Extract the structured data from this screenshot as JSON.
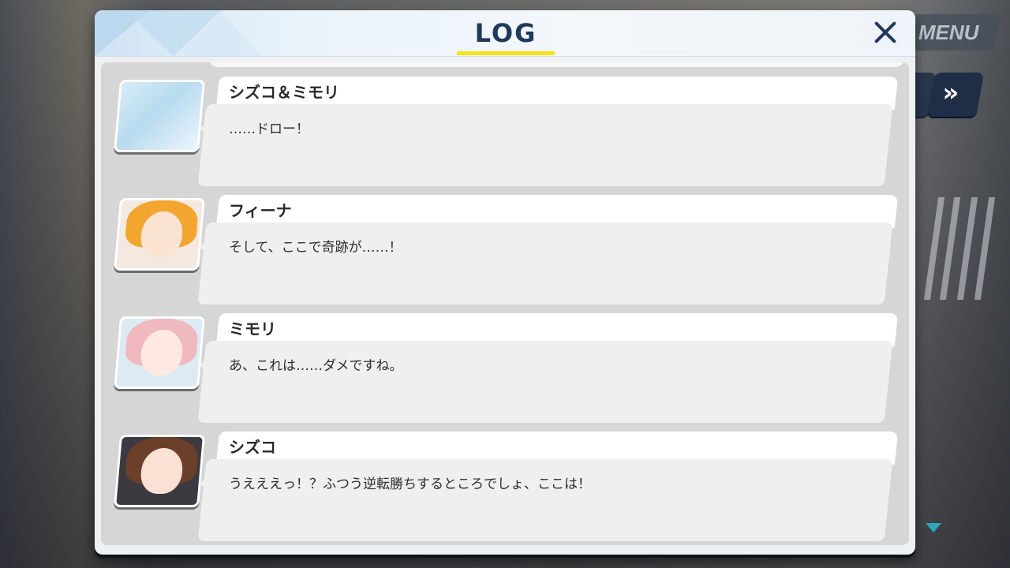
{
  "hud": {
    "menu_label": "MENU",
    "skip_glyph": "»"
  },
  "dialog": {
    "title": "LOG",
    "close_icon": "close-icon"
  },
  "entries": [
    {
      "speaker": "シズコ＆ミモリ",
      "text": "……ドロー！",
      "avatar": "blank"
    },
    {
      "speaker": "フィーナ",
      "text": "そして、ここで奇跡が……！",
      "avatar": "fina"
    },
    {
      "speaker": "ミモリ",
      "text": "あ、これは……ダメですね。",
      "avatar": "mimori"
    },
    {
      "speaker": "シズコ",
      "text": "うえええっ！？ふつう逆転勝ちするところでしょ、ここは！",
      "avatar": "shizuko"
    }
  ],
  "colors": {
    "title": "#1f3a5a",
    "underline": "#f5e31b",
    "scroll_arrow": "#2fa7b5"
  }
}
